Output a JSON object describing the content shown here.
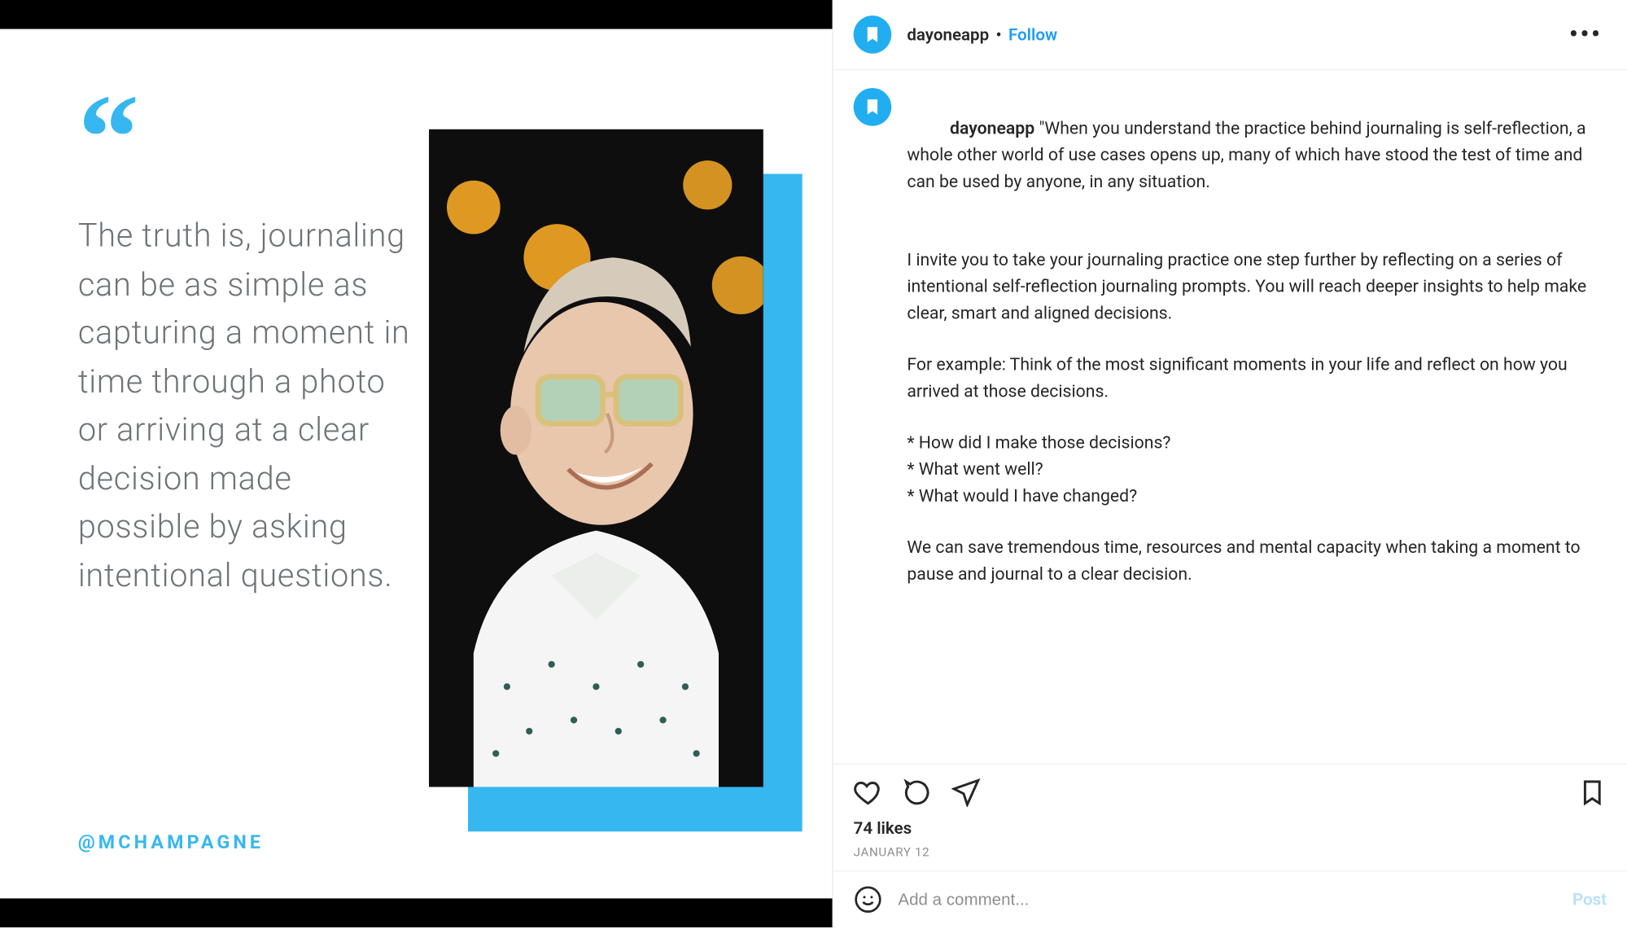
{
  "card": {
    "quote_text": "The truth is, journaling can be as simple as capturing a moment in time through a photo or arriving at a clear decision made possible by asking intentional questions.",
    "handle": "@MCHAMPAGNE"
  },
  "post": {
    "header": {
      "username": "dayoneapp",
      "follow_label": "Follow"
    },
    "caption": {
      "author": "dayoneapp",
      "p1": "\"When you understand the practice behind journaling is self-reflection, a whole other world of use cases opens up, many of which have stood the test of time and can be used by anyone, in any situation.",
      "p2": "I invite you to take your journaling practice one step further by reflecting on a series of intentional self-reflection journaling prompts. You will reach deeper insights to help make clear, smart and aligned decisions.",
      "p3": "For example: Think of the most significant moments in your life and reflect on how you arrived at those decisions.",
      "p4": "* How did I make those decisions?\n* What went well?\n* What would I have changed?",
      "p5": "We can save tremendous time, resources and mental capacity when taking a moment to pause and journal to a clear decision."
    },
    "likes_label": "74 likes",
    "date_label": "JANUARY 12",
    "comment_placeholder": "Add a comment...",
    "post_button_label": "Post"
  }
}
